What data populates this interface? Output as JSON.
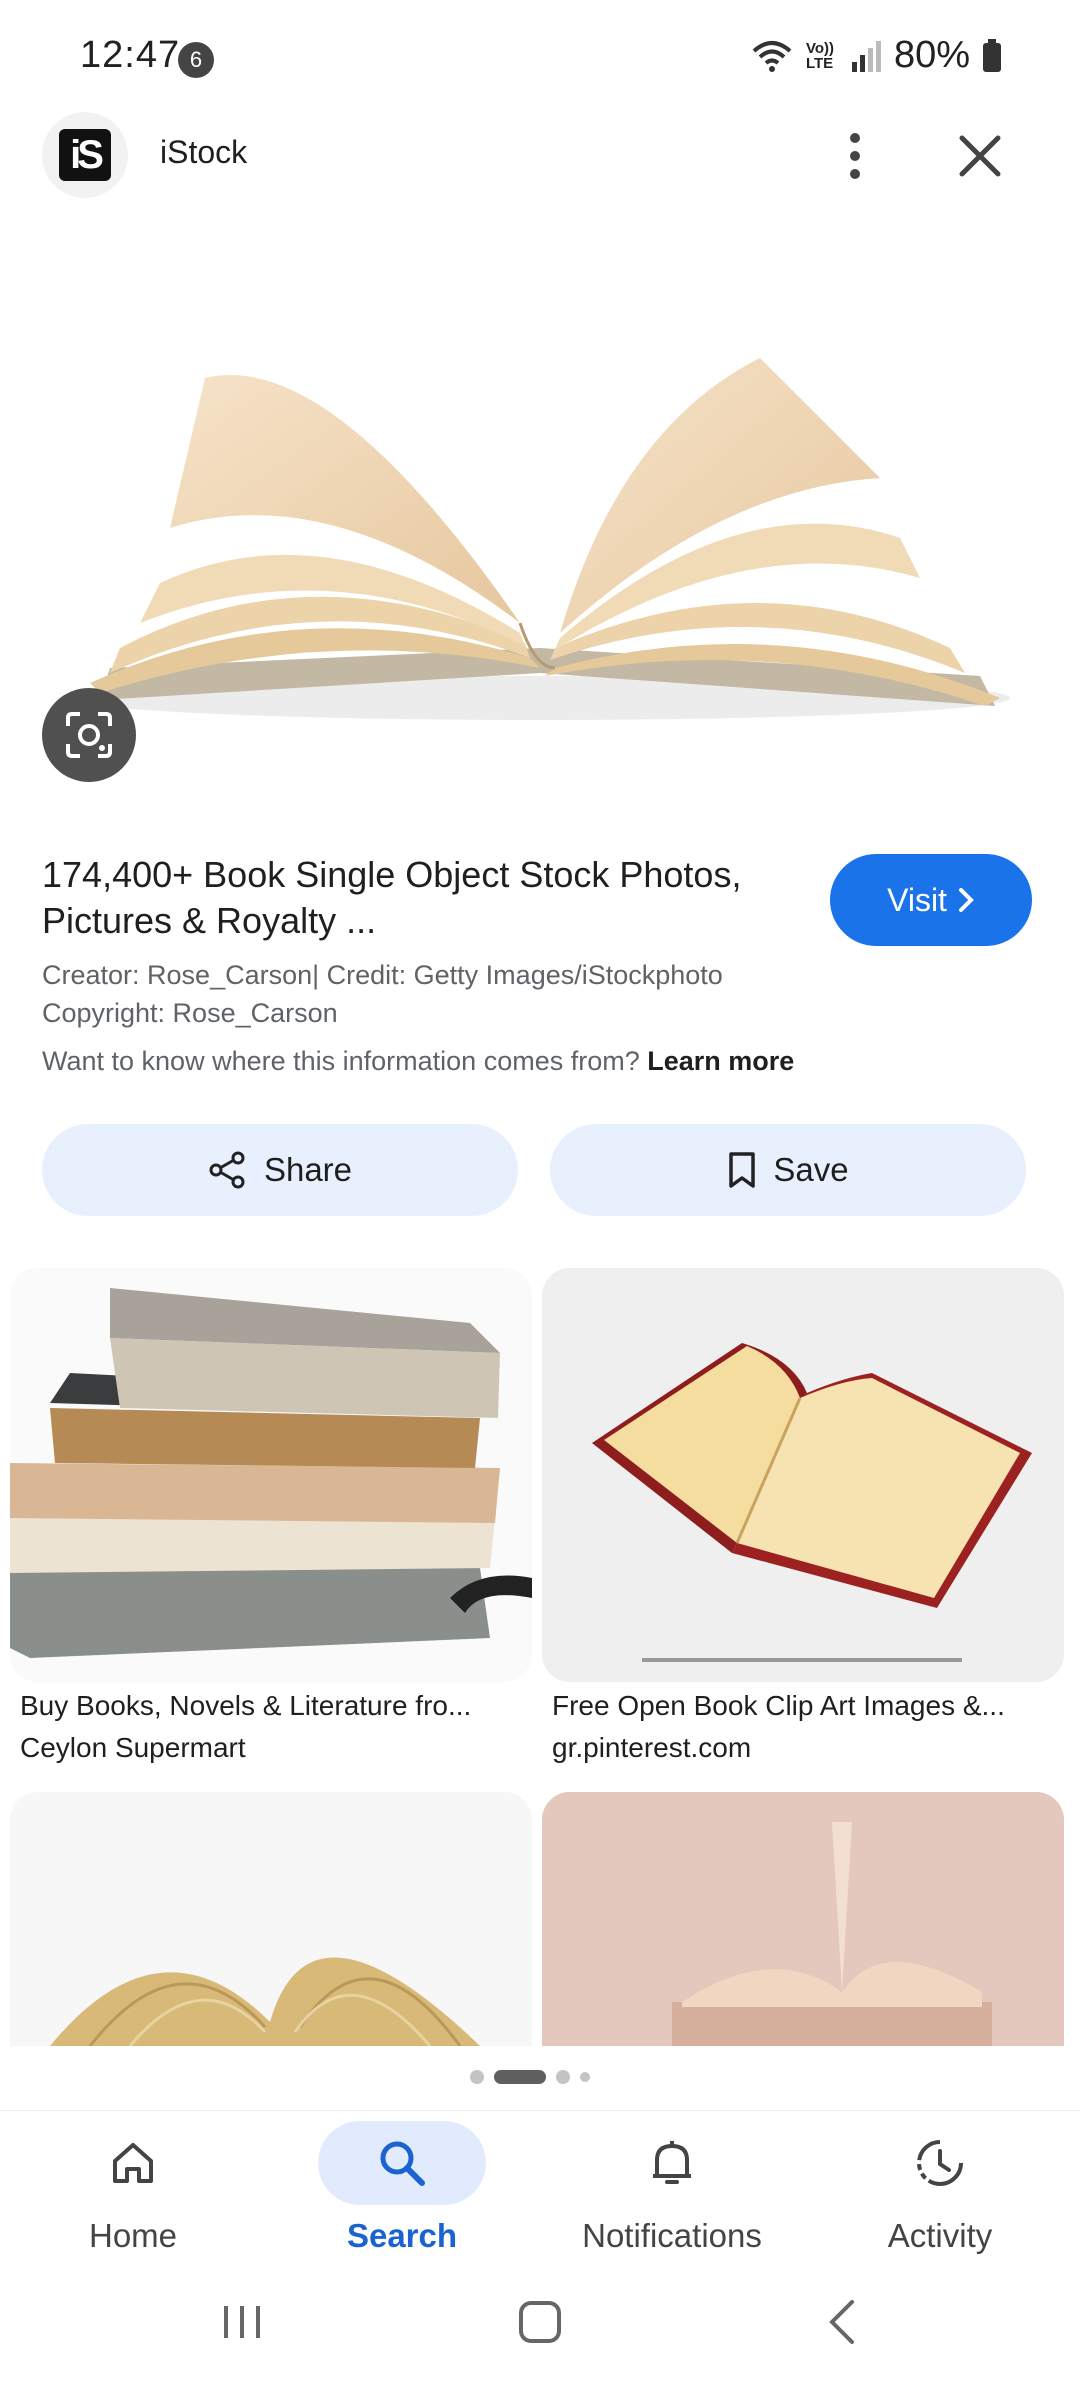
{
  "status_bar": {
    "time": "12:47",
    "notification_count": "6",
    "battery": "80%",
    "network": "Vo)) LTE"
  },
  "header": {
    "site_name": "iStock",
    "logo_text": "iS"
  },
  "result": {
    "title": "174,400+ Book Single Object Stock Photos, Pictures & Royalty ...",
    "visit_label": "Visit",
    "creator": "Creator: Rose_Carson| Credit: Getty Images/iStockphoto",
    "copyright": "Copyright: Rose_Carson",
    "info_question": "Want to know where this information comes from?",
    "learn_more": "Learn more"
  },
  "actions": {
    "share_label": "Share",
    "save_label": "Save"
  },
  "related": [
    {
      "title": "Buy Books, Novels & Literature fro...",
      "source": "Ceylon Supermart"
    },
    {
      "title": "Free Open Book Clip Art Images &...",
      "source": "gr.pinterest.com"
    }
  ],
  "bottom_nav": [
    {
      "label": "Home",
      "icon": "home-icon"
    },
    {
      "label": "Search",
      "icon": "search-icon",
      "active": true
    },
    {
      "label": "Notifications",
      "icon": "bell-icon"
    },
    {
      "label": "Activity",
      "icon": "activity-icon"
    }
  ],
  "colors": {
    "accent": "#1a73e8",
    "pill_bg": "#e8f0fe"
  }
}
